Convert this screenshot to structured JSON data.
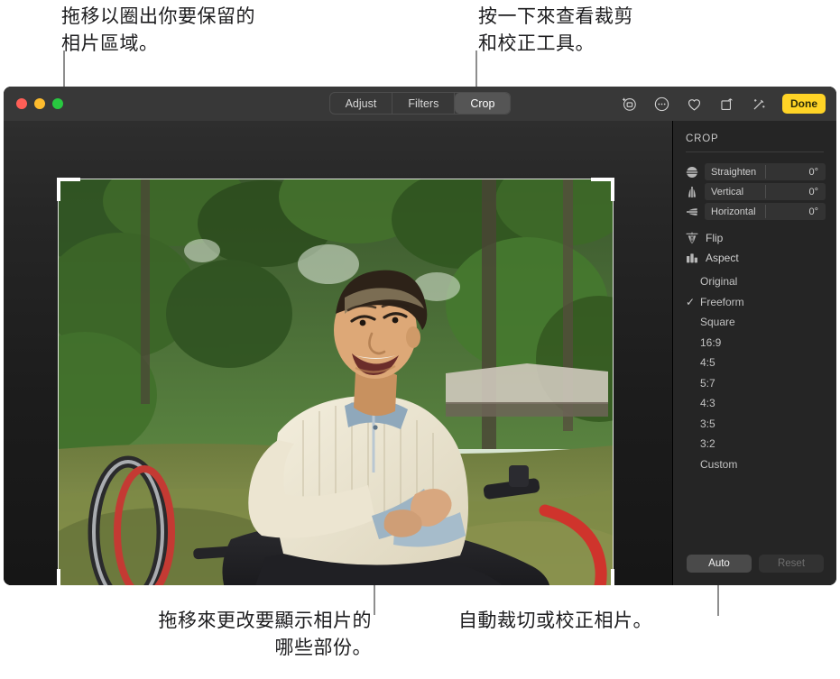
{
  "callouts": {
    "top_left": "拖移以圈出你要保留的\n相片區域。",
    "top_right": "按一下來查看裁剪\n和校正工具。",
    "bottom_left": "拖移來更改要顯示相片的\n哪些部份。",
    "bottom_right": "自動裁切或校正相片。"
  },
  "window": {
    "traffic_lights": [
      {
        "name": "close",
        "color": "#ff5f57"
      },
      {
        "name": "minimize",
        "color": "#febc2e"
      },
      {
        "name": "zoom",
        "color": "#28c840"
      }
    ],
    "segmented_control": {
      "items": [
        {
          "label": "Adjust",
          "active": false
        },
        {
          "label": "Filters",
          "active": false
        },
        {
          "label": "Crop",
          "active": true
        }
      ]
    },
    "toolbar_icons": [
      {
        "name": "retouch-icon"
      },
      {
        "name": "more-options-icon"
      },
      {
        "name": "favorite-heart-icon"
      },
      {
        "name": "rotate-icon"
      },
      {
        "name": "auto-enhance-icon"
      }
    ],
    "done_label": "Done"
  },
  "sidebar": {
    "title": "CROP",
    "sliders": [
      {
        "icon": "straighten-icon",
        "label": "Straighten",
        "value": "0°"
      },
      {
        "icon": "vertical-icon",
        "label": "Vertical",
        "value": "0°"
      },
      {
        "icon": "horizontal-icon",
        "label": "Horizontal",
        "value": "0°"
      }
    ],
    "tools": [
      {
        "icon": "flip-icon",
        "label": "Flip"
      },
      {
        "icon": "aspect-icon",
        "label": "Aspect"
      }
    ],
    "aspect_options": [
      {
        "label": "Original",
        "checked": false
      },
      {
        "label": "Freeform",
        "checked": true
      },
      {
        "label": "Square",
        "checked": false
      },
      {
        "label": "16:9",
        "checked": false
      },
      {
        "label": "4:5",
        "checked": false
      },
      {
        "label": "5:7",
        "checked": false
      },
      {
        "label": "4:3",
        "checked": false
      },
      {
        "label": "3:5",
        "checked": false
      },
      {
        "label": "3:2",
        "checked": false
      },
      {
        "label": "Custom",
        "checked": false
      }
    ],
    "check_glyph": "✓",
    "auto_label": "Auto",
    "reset_label": "Reset"
  },
  "photo": {
    "description": "smiling-man-in-wheelchair-in-green-garden"
  },
  "colors": {
    "accent": "#FFD426",
    "window_bg": "#1e1e1e",
    "titlebar_bg": "#383838",
    "sidebar_bg": "#252525"
  }
}
